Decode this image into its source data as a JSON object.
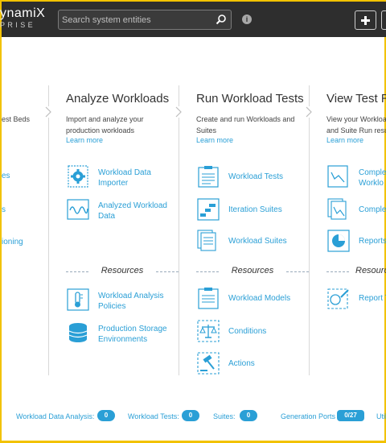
{
  "header": {
    "brand_main": "ynamiX",
    "brand_sub": "PRISE",
    "search_placeholder": "Search system entities"
  },
  "left_fragment": {
    "desc": "est Beds",
    "links": [
      "es",
      "s",
      "ioning"
    ]
  },
  "columns": [
    {
      "title": "Analyze Workloads",
      "desc_lines": [
        "Import and analyze your",
        "production workloads"
      ],
      "learn_more": "Learn more",
      "items": [
        {
          "label": "Workload Data Importer",
          "icon": "gear-clipboard-icon"
        },
        {
          "label": "Analyzed Workload Data",
          "icon": "waveform-icon"
        }
      ],
      "resources_title": "Resources",
      "resources": [
        {
          "label": "Workload Analysis Policies",
          "icon": "thermometer-icon"
        },
        {
          "label": "Production Storage Environments",
          "icon": "database-icon"
        }
      ]
    },
    {
      "title": "Run Workload Tests",
      "desc_lines": [
        "Create and run Workloads and",
        "Suites"
      ],
      "learn_more": "Learn more",
      "items": [
        {
          "label": "Workload Tests",
          "icon": "clipboard-list-icon"
        },
        {
          "label": "Iteration Suites",
          "icon": "gantt-icon"
        },
        {
          "label": "Workload Suites",
          "icon": "stacked-pages-icon"
        }
      ],
      "resources_title": "Resources",
      "resources": [
        {
          "label": "Workload Models",
          "icon": "clipboard-list-icon"
        },
        {
          "label": "Conditions",
          "icon": "scale-icon"
        },
        {
          "label": "Actions",
          "icon": "gavel-icon"
        }
      ]
    },
    {
      "title": "View Test Re",
      "desc_lines": [
        "View your Workload",
        "and Suite Run results"
      ],
      "learn_more": "Learn more",
      "items": [
        {
          "label": "Complet",
          "label2": "Worklo",
          "icon": "line-chart-icon"
        },
        {
          "label": "Complet",
          "icon": "stacked-chart-icon"
        },
        {
          "label": "Reports",
          "icon": "pie-chart-icon"
        }
      ],
      "resources_title": "Resource",
      "resources": [
        {
          "label": "Report T",
          "icon": "report-edit-icon"
        }
      ]
    }
  ],
  "footer": {
    "stats": [
      {
        "label": "Workload Data Analysis:",
        "value": "0"
      },
      {
        "label": "Workload Tests:",
        "value": "0"
      },
      {
        "label": "Suites:",
        "value": "0"
      },
      {
        "label": "Generation Ports",
        "value": "0/27"
      },
      {
        "label": "Util",
        "value": ""
      }
    ]
  },
  "colors": {
    "accent": "#2a9fd6",
    "topbar": "#2e2e2e",
    "frame": "#f2c200"
  }
}
